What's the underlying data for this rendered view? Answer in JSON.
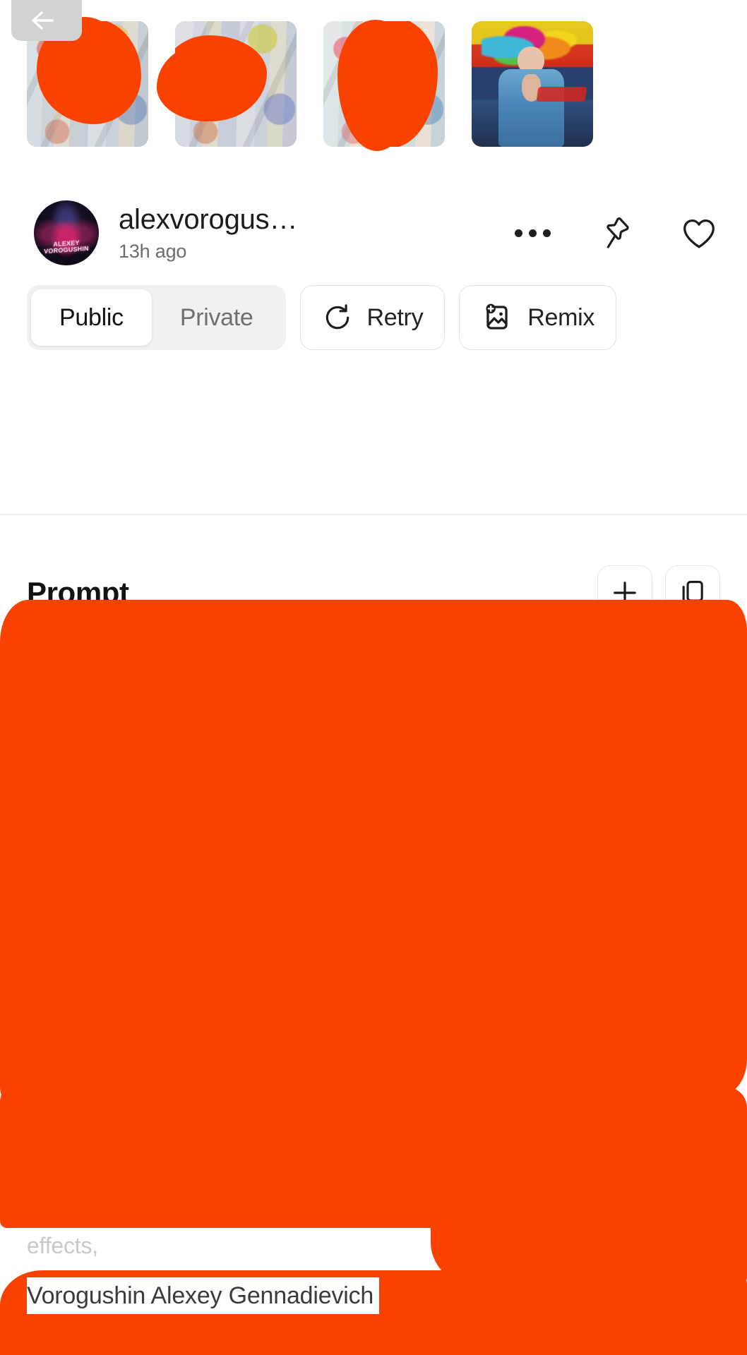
{
  "nav": {
    "back_icon": "arrow-left-icon"
  },
  "thumbnails": [
    {
      "alt": "pop-art poster wall variation 1",
      "redacted": true
    },
    {
      "alt": "pop-art poster wall variation 2",
      "redacted": true
    },
    {
      "alt": "pop-art poster wall variation 3",
      "redacted": true
    },
    {
      "alt": "woman with rainbow hair on comic-book wall",
      "redacted": false
    }
  ],
  "author": {
    "name": "alexvorogus…",
    "time": "13h ago",
    "avatar_mark_top": "ALEXEY",
    "avatar_mark_bottom": "VOROGUSHIN",
    "more_icon": "more-horizontal-icon",
    "pin_icon": "pin-icon",
    "like_icon": "heart-icon"
  },
  "visibility": {
    "options": [
      "Public",
      "Private"
    ],
    "selected": "Public"
  },
  "actions": {
    "retry_label": "Retry",
    "retry_icon": "rotate-ccw-icon",
    "remix_label": "Remix",
    "remix_icon": "image-plus-icon"
  },
  "prompt": {
    "title": "Prompt",
    "add_icon": "plus-icon",
    "copy_icon": "copy-icon",
    "ghost_text": "effects,",
    "visible_text": "Vorogushin Alexey Gennadievich"
  },
  "colors": {
    "redaction": "#FA4200",
    "background": "#FFFFFF",
    "segment_track": "#F1F1F1",
    "border": "#E2E2E2",
    "text_primary": "#121212",
    "text_muted": "#6D6D6D"
  }
}
